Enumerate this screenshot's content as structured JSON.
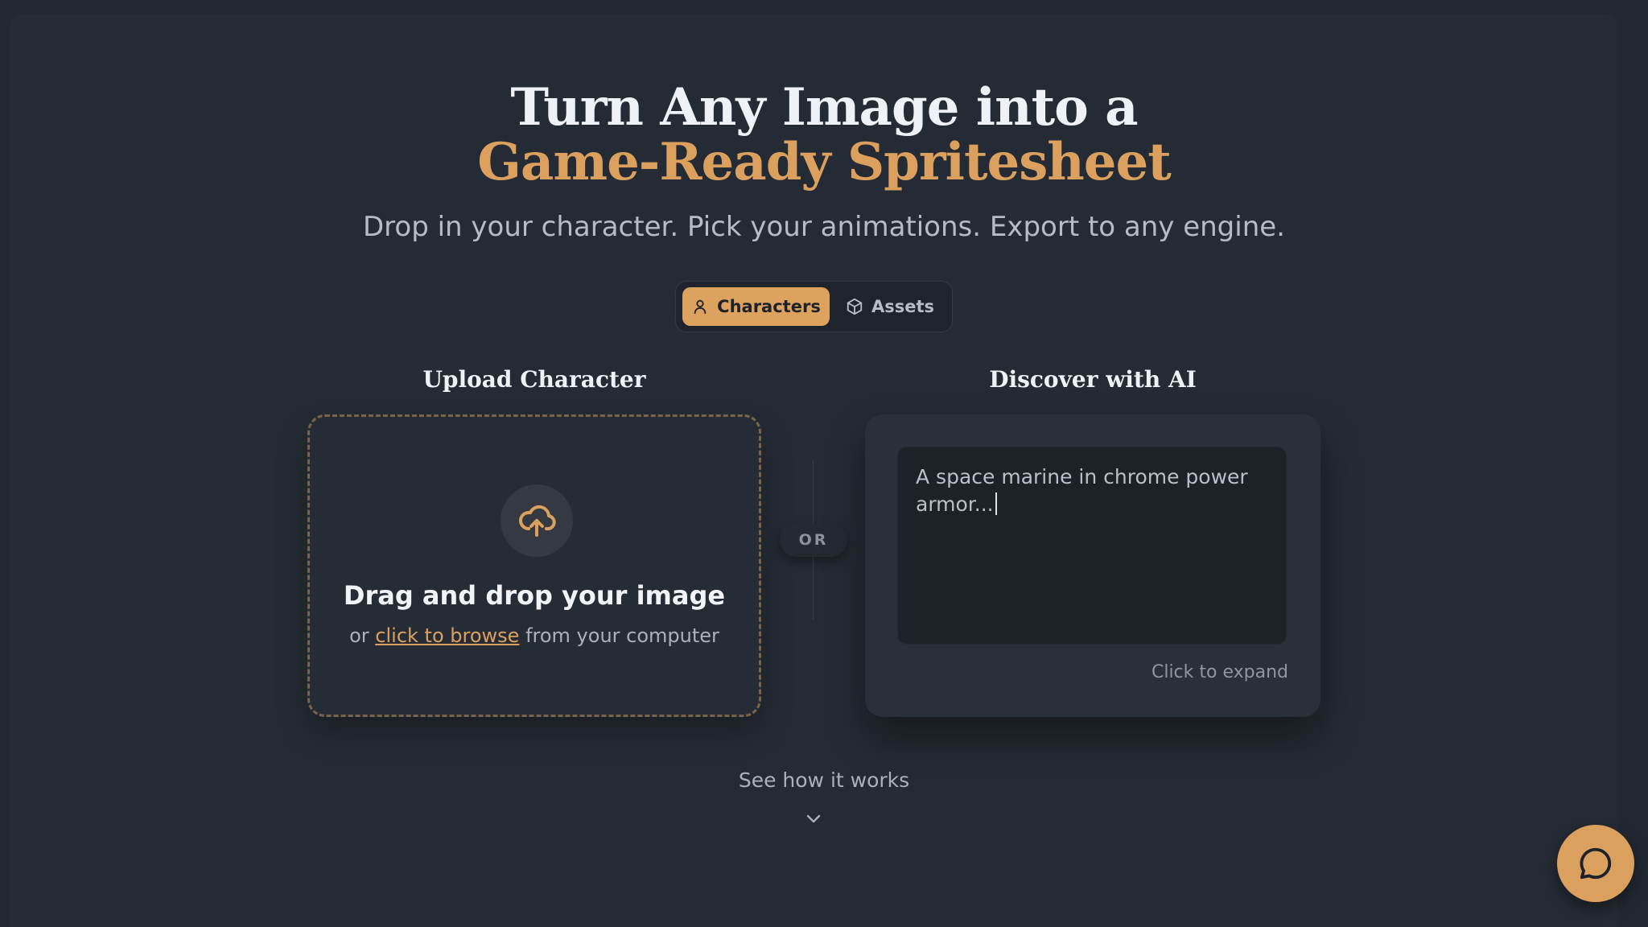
{
  "hero": {
    "title_line1": "Turn Any Image into a",
    "title_line2": "Game-Ready Spritesheet",
    "subtitle": "Drop in your character. Pick your animations. Export to any engine."
  },
  "mode_toggle": {
    "active": "Characters",
    "tabs": [
      {
        "label": "Characters",
        "icon": "user-icon",
        "active": true
      },
      {
        "label": "Assets",
        "icon": "box-icon",
        "active": false
      }
    ]
  },
  "upload": {
    "heading": "Upload Character",
    "icon": "cloud-upload-icon",
    "title": "Drag and drop your image",
    "sub_prefix": "or",
    "browse_link": "click to browse",
    "sub_suffix": "from your computer"
  },
  "divider": {
    "label": "OR"
  },
  "ai": {
    "heading": "Discover with AI",
    "prompt_value": "A space marine in chrome power armor...",
    "expand_label": "Click to expand"
  },
  "footer": {
    "how_label": "See how it works",
    "chevron_icon": "chevron-down-icon"
  },
  "chat": {
    "icon": "chat-bubble-icon"
  },
  "colors": {
    "accent": "#dca05e",
    "background": "#252b34",
    "card": "#29303a"
  }
}
